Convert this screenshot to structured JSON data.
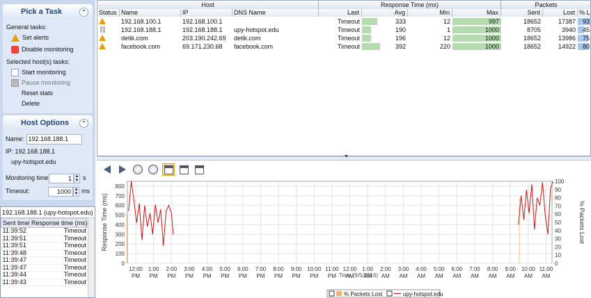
{
  "tasks": {
    "title": "Pick a Task",
    "general_label": "General tasks:",
    "set_alerts": "Set alerts",
    "disable_monitoring": "Disable monitoring",
    "selected_label": "Selected host(s) tasks:",
    "start_monitoring": "Start monitoring",
    "pause_monitoring": "Pause monitoring",
    "reset_stats": "Reset stats",
    "delete": "Delete"
  },
  "host_options": {
    "title": "Host Options",
    "name_label": "Name:",
    "name_value": "192.168.188.1",
    "ip_label": "IP: 192.168.188.1",
    "dns": "upy-hotspot.edu",
    "monitoring_label": "Monitoring time:",
    "monitoring_value": "1",
    "monitoring_unit": "s",
    "timeout_label": "Timeout:",
    "timeout_value": "1000",
    "timeout_unit": "ms"
  },
  "history": {
    "title": "192.168.188.1 (upy-hotspot.edu)",
    "col_time": "Sent time",
    "col_resp": "Response time (ms)",
    "rows": [
      {
        "time": "11:39:52",
        "resp": "Timeout"
      },
      {
        "time": "11:39:51",
        "resp": "Timeout"
      },
      {
        "time": "11:39:51",
        "resp": "Timeout"
      },
      {
        "time": "11:39:48",
        "resp": "Timeout"
      },
      {
        "time": "11:39:47",
        "resp": "Timeout"
      },
      {
        "time": "11:39:47",
        "resp": "Timeout"
      },
      {
        "time": "11:39:44",
        "resp": "Timeout"
      },
      {
        "time": "11:39:43",
        "resp": "Timeout"
      }
    ]
  },
  "grid": {
    "group_host": "Host",
    "group_resp": "Response Time (ms)",
    "group_packets": "Packets",
    "cols": {
      "status": "Status",
      "name": "Name",
      "ip": "IP",
      "dns": "DNS Name",
      "last": "Last",
      "avg": "Avg",
      "min": "Min",
      "max": "Max",
      "sent": "Sent",
      "lost": "Lost",
      "loss": "% Loss"
    },
    "rows": [
      {
        "status": "warning",
        "name": "192.168.100.1",
        "ip": "192.168.100.1",
        "dns": "",
        "last": "Timeout",
        "avg": "333",
        "min": "12",
        "max": "997",
        "sent": "18652",
        "lost": "17387",
        "loss": "93",
        "avg_frac": 0.33,
        "max_frac": 1.0,
        "loss_frac": 0.93
      },
      {
        "status": "paused",
        "name": "192.168.188.1",
        "ip": "192.168.188.1",
        "dns": "upy-hotspot.edu",
        "last": "Timeout",
        "avg": "190",
        "min": "1",
        "max": "1000",
        "sent": "8705",
        "lost": "3940",
        "loss": "45",
        "avg_frac": 0.19,
        "max_frac": 1.0,
        "loss_frac": 0.45
      },
      {
        "status": "warning",
        "name": "detik.com",
        "ip": "203.190.242.69",
        "dns": "detik.com",
        "last": "Timeout",
        "avg": "196",
        "min": "12",
        "max": "1000",
        "sent": "18652",
        "lost": "13986",
        "loss": "75",
        "avg_frac": 0.2,
        "max_frac": 1.0,
        "loss_frac": 0.75
      },
      {
        "status": "warning",
        "name": "facebook.com",
        "ip": "69.171.230.68",
        "dns": "facebook.com",
        "last": "Timeout",
        "avg": "392",
        "min": "220",
        "max": "1000",
        "sent": "18652",
        "lost": "14922",
        "loss": "80",
        "avg_frac": 0.39,
        "max_frac": 1.0,
        "loss_frac": 0.8
      }
    ]
  },
  "colors": {
    "bar_green": "#b6dbb0",
    "bar_blue": "#a9c7ec",
    "line_red": "#cc1111",
    "fill_orange": "#f5b26b",
    "fill_green": "#cfe8c6"
  },
  "toolbar": [
    "back-arrow-icon",
    "forward-arrow-icon",
    "clock-icon",
    "clock-alt-icon",
    "calendar-day-icon",
    "calendar-week-icon",
    "calendar-month-icon"
  ],
  "chart_data": {
    "type": "line",
    "ylabel": "Response Time (ms)",
    "y2label": "% Packets Lost",
    "ylim": [
      0,
      850
    ],
    "y2lim": [
      0,
      100
    ],
    "yticks": [
      "0",
      "100",
      "200",
      "300",
      "400",
      "500",
      "600",
      "700",
      "800"
    ],
    "y2ticks": [
      "0",
      "10",
      "20",
      "30",
      "40",
      "50",
      "60",
      "70",
      "80",
      "90",
      "100"
    ],
    "x": [
      "12:00 PM",
      "1:00 PM",
      "2:00 PM",
      "3:00 PM",
      "4:00 PM",
      "5:00 PM",
      "6:00 PM",
      "7:00 PM",
      "8:00 PM",
      "9:00 PM",
      "10:00 PM",
      "11:00 PM",
      "12:00 AM",
      "1:00 AM",
      "2:00 AM",
      "3:00 AM",
      "4:00 AM",
      "5:00 AM",
      "6:00 AM",
      "7:00 AM",
      "8:00 AM",
      "9:00 AM",
      "10:00 AM",
      "11:00 AM"
    ],
    "xlabel_partial": "Time (9/5/2016)",
    "series": [
      {
        "name": "% Packets Lost",
        "kind": "area",
        "values_by_hour": {
          "11.5": 60,
          "12.0": 70,
          "12.5": 65,
          "13.0": 72,
          "13.5": 62,
          "14.0": 58,
          "9.5": 80,
          "10.0": 90,
          "10.5": 88,
          "11.0": 85
        }
      },
      {
        "name": "upy-hotspot.edu",
        "kind": "line",
        "points": [
          [
            11.6,
            540
          ],
          [
            11.75,
            860
          ],
          [
            11.9,
            650
          ],
          [
            12.05,
            420
          ],
          [
            12.2,
            620
          ],
          [
            12.35,
            240
          ],
          [
            12.5,
            600
          ],
          [
            12.65,
            380
          ],
          [
            12.8,
            520
          ],
          [
            12.95,
            300
          ],
          [
            13.1,
            610
          ],
          [
            13.25,
            420
          ],
          [
            13.4,
            560
          ],
          [
            13.55,
            180
          ],
          [
            13.7,
            540
          ],
          [
            13.85,
            600
          ],
          [
            14.0,
            520
          ],
          [
            14.1,
            300
          ],
          [
            9.45,
            400
          ],
          [
            9.6,
            700
          ],
          [
            9.75,
            450
          ],
          [
            9.9,
            760
          ],
          [
            10.05,
            520
          ],
          [
            10.2,
            820
          ],
          [
            10.35,
            350
          ],
          [
            10.5,
            680
          ],
          [
            10.65,
            600
          ],
          [
            10.8,
            840
          ],
          [
            10.95,
            500
          ],
          [
            11.1,
            300
          ],
          [
            11.25,
            780
          ],
          [
            11.4,
            850
          ]
        ]
      }
    ],
    "legend": "bottom"
  }
}
